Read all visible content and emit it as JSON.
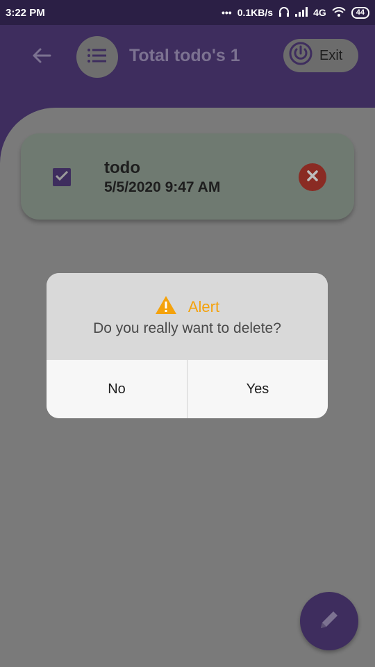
{
  "status_bar": {
    "time": "3:22 PM",
    "network_speed": "0.1KB/s",
    "signal_text": "4G",
    "battery": "44"
  },
  "header": {
    "title": "Total todo's 1",
    "exit_label": "Exit",
    "icons": {
      "back": "arrow-left-icon",
      "menu": "list-icon",
      "exit": "power-icon"
    }
  },
  "todos": [
    {
      "title": "todo",
      "date": "5/5/2020 9:47 AM",
      "checked": true
    }
  ],
  "dialog": {
    "title": "Alert",
    "message": "Do you really want to delete?",
    "no_label": "No",
    "yes_label": "Yes"
  },
  "colors": {
    "primary": "#3e2d5e",
    "alert": "#f4a20c",
    "delete": "#c0392b"
  }
}
